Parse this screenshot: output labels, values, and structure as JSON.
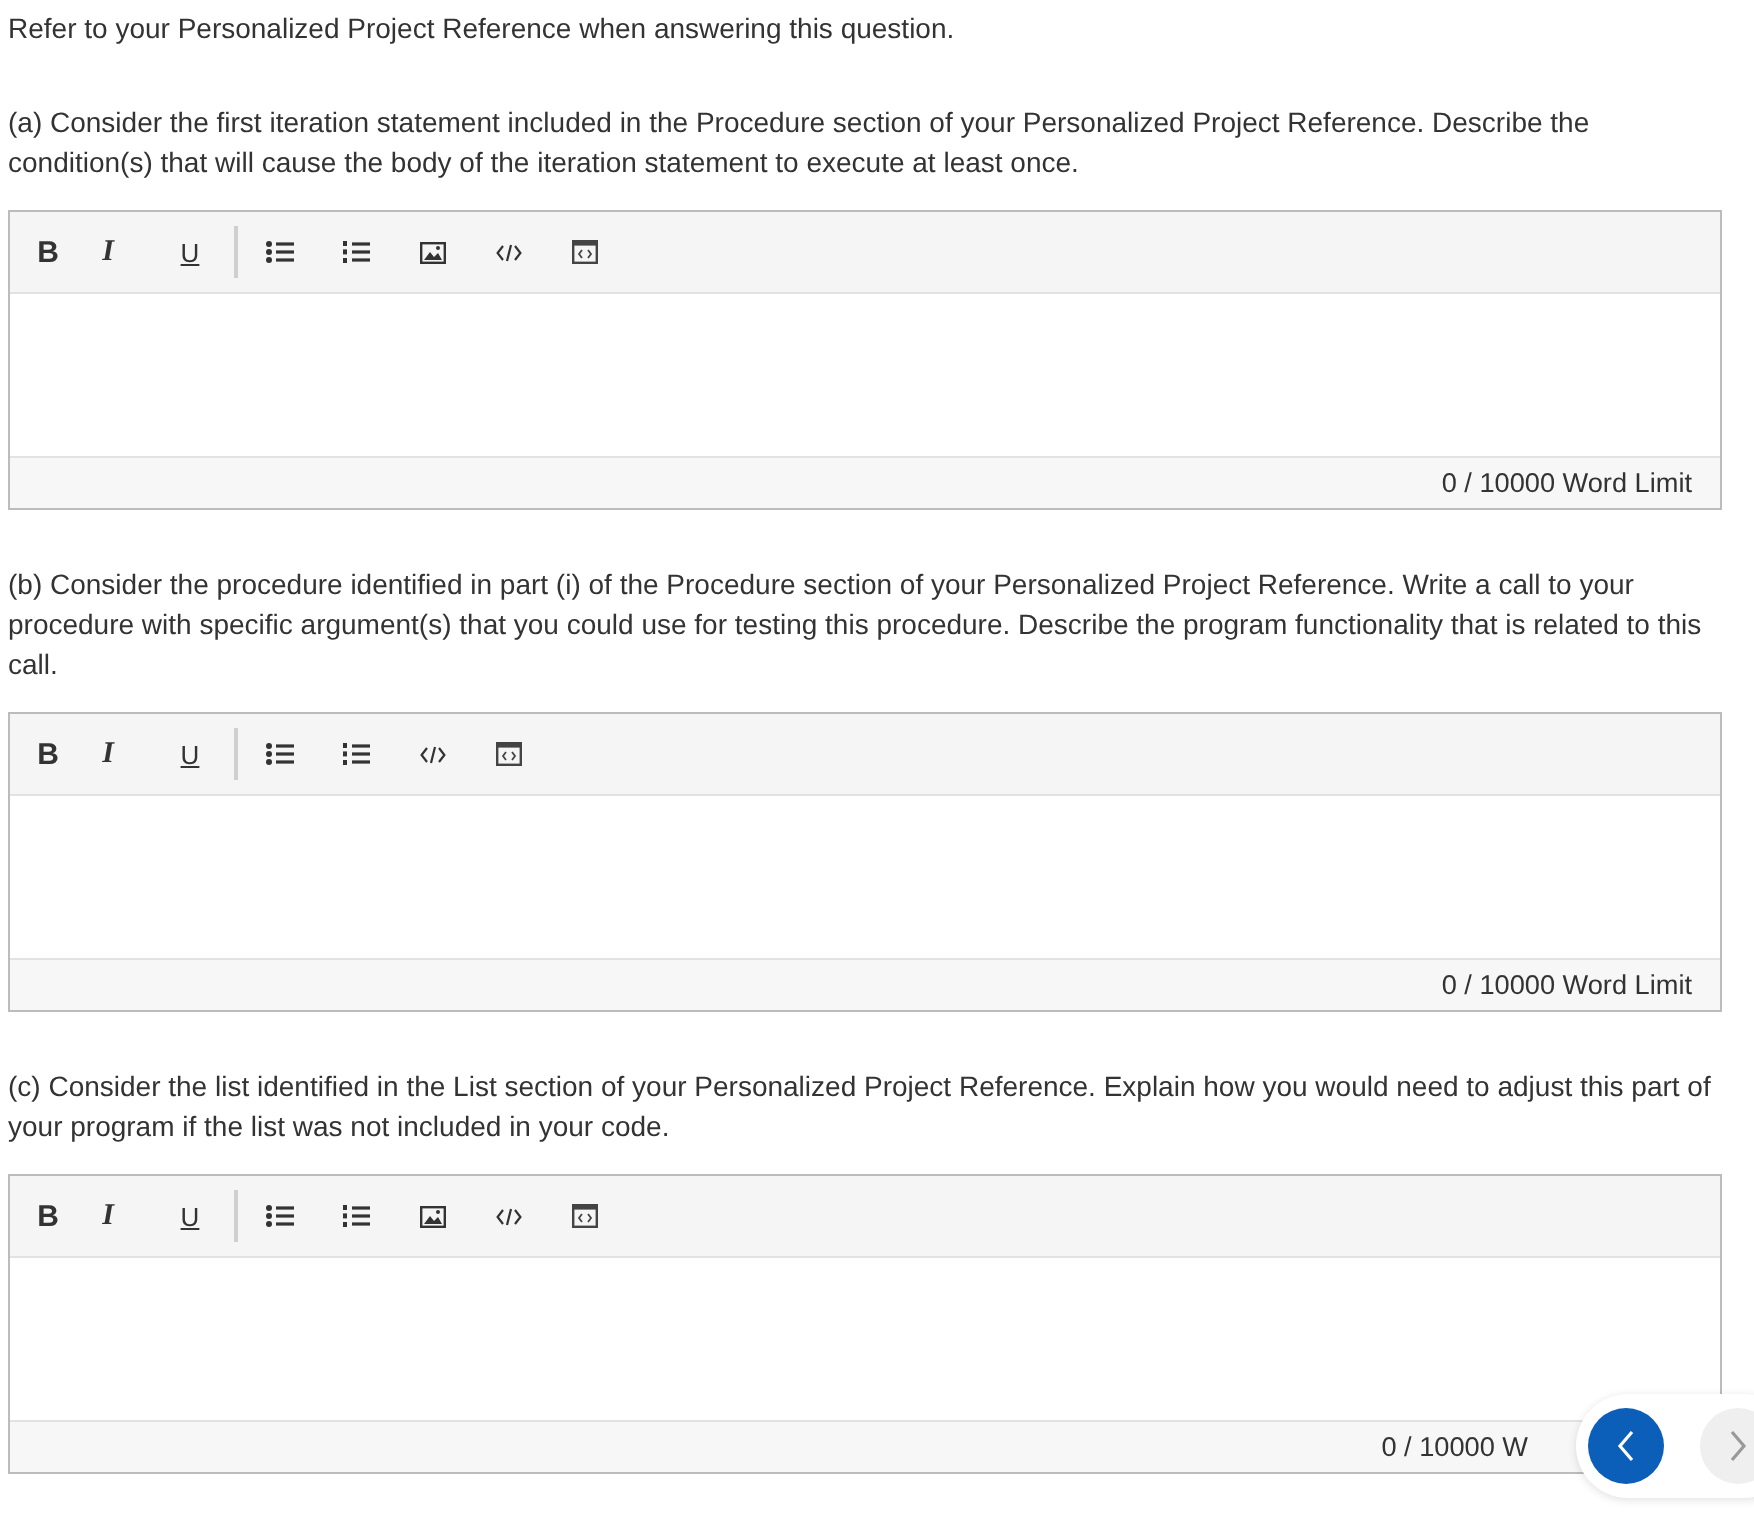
{
  "intro": "Refer to your Personalized Project Reference when answering this question.",
  "questions": [
    {
      "prompt": "(a) Consider the first iteration statement included in the Procedure section of your Personalized Project Reference. Describe the condition(s) that will cause the body of the iteration statement to execute at least once.",
      "tools": [
        {
          "kind": "bold",
          "label": "B"
        },
        {
          "kind": "italic",
          "label": "I"
        },
        {
          "kind": "underline",
          "label": "U"
        },
        {
          "kind": "separator"
        },
        {
          "kind": "bullets"
        },
        {
          "kind": "numbers"
        },
        {
          "kind": "image"
        },
        {
          "kind": "code"
        },
        {
          "kind": "embed"
        }
      ],
      "word_limit": "0 / 10000 Word Limit"
    },
    {
      "prompt": "(b) Consider the procedure identified in part (i) of the Procedure section of your Personalized Project Reference. Write a call to your procedure with specific argument(s) that you could use for testing this procedure. Describe the program functionality that is related to this call.",
      "tools": [
        {
          "kind": "bold",
          "label": "B"
        },
        {
          "kind": "italic",
          "label": "I"
        },
        {
          "kind": "underline",
          "label": "U"
        },
        {
          "kind": "separator"
        },
        {
          "kind": "bullets"
        },
        {
          "kind": "numbers"
        },
        {
          "kind": "code"
        },
        {
          "kind": "embed"
        }
      ],
      "word_limit": "0 / 10000 Word Limit"
    },
    {
      "prompt": "(c) Consider the list identified in the List section of your Personalized Project Reference. Explain how you would need to adjust this part of your program if the list was not included in your code.",
      "tools": [
        {
          "kind": "bold",
          "label": "B"
        },
        {
          "kind": "italic",
          "label": "I"
        },
        {
          "kind": "underline",
          "label": "U"
        },
        {
          "kind": "separator"
        },
        {
          "kind": "bullets"
        },
        {
          "kind": "numbers"
        },
        {
          "kind": "image"
        },
        {
          "kind": "code"
        },
        {
          "kind": "embed"
        }
      ],
      "word_limit": "0 / 10000 W"
    }
  ],
  "nav": {
    "previous_disabled": false,
    "next_disabled": true
  }
}
